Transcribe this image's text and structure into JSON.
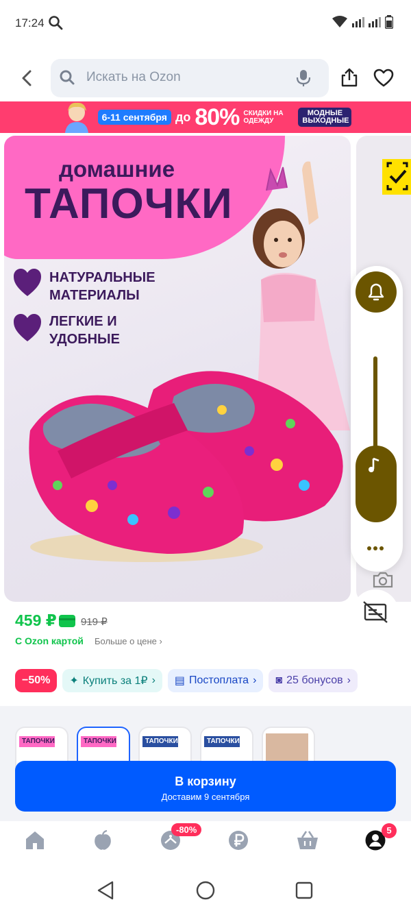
{
  "status_bar": {
    "time": "17:24"
  },
  "search": {
    "placeholder": "Искать на Ozon"
  },
  "banner": {
    "dates": "6-11 сентября",
    "upto": "до",
    "discount": "80%",
    "tagline": "СКИДКИ НА ОДЕЖДУ",
    "event": "МОДНЫЕ ВЫХОДНЫЕ"
  },
  "product_image": {
    "heading_small": "домашние",
    "heading_big": "ТАПОЧКИ",
    "features": [
      "НАТУРАЛЬНЫЕ МАТЕРИАЛЫ",
      "ЛЕГКИЕ И УДОБНЫЕ"
    ]
  },
  "price": {
    "current": "459 ₽",
    "old": "919 ₽",
    "card_label": "С Ozon картой",
    "more_label": "Больше о цене"
  },
  "chips": [
    {
      "label": "−50%"
    },
    {
      "label": "Купить за 1₽"
    },
    {
      "label": "Постоплата"
    },
    {
      "label": "25 бонусов"
    }
  ],
  "thumbnails": [
    {
      "label": "ТАПОЧКИ"
    },
    {
      "label": "ТАПОЧКИ"
    },
    {
      "label": "ТАПОЧКИ"
    },
    {
      "label": "ТАПОЧКИ"
    },
    {
      "label": ""
    }
  ],
  "cart": {
    "title": "В корзину",
    "subtitle": "Доставим 9 сентября"
  },
  "bottom_nav": {
    "promo_badge": "-80%",
    "profile_badge": "5"
  },
  "colors": {
    "brand_blue": "#005bff",
    "price_green": "#10c44c",
    "promo_pink": "#ff3d6f",
    "badge_red": "#ff2e5b"
  }
}
